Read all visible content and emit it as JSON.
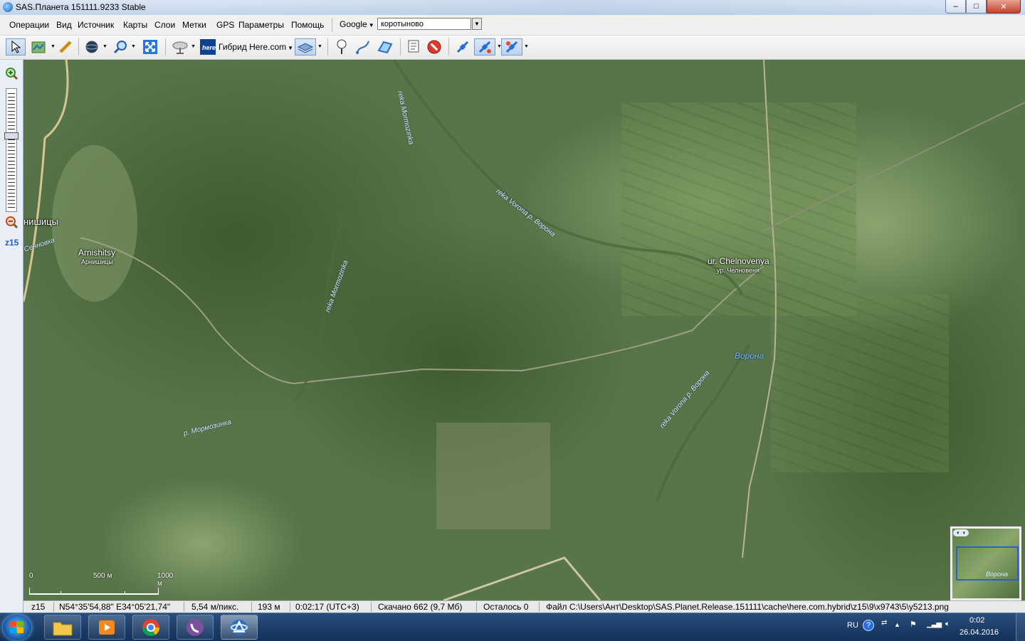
{
  "window": {
    "title": "SAS.Планета 151111.9233 Stable",
    "controls": {
      "minimize": "–",
      "maximize": "□",
      "close": "✕"
    }
  },
  "menu": {
    "items": [
      "Операции",
      "Вид",
      "Источник",
      "Карты",
      "Слои",
      "Метки",
      "GPS",
      "Параметры",
      "Помощь"
    ],
    "search_source": "Google",
    "search_value": "коротыново"
  },
  "toolbar": {
    "map_type_label": "Гибрид Here.com",
    "buttons": [
      "select-arrow",
      "map-source",
      "ruler",
      "globe",
      "zoom-magnifier",
      "fullscreen",
      "satellite-dish",
      "here-logo",
      "layers",
      "placemark",
      "path-tool",
      "polygon-tool",
      "marks-list",
      "delete-marks",
      "gps-connect",
      "gps-track",
      "gps-center"
    ]
  },
  "zoom": {
    "level": "z15"
  },
  "map": {
    "labels": {
      "nishitsy": "нишицы",
      "sennovka": "Сенновка",
      "arnishitsy": "Arnishitsy",
      "arnishitsy_ru": "Арнишицы",
      "mormozinka_top": "reka Mormozinka",
      "mormozinka_mid": "reka Mormozinka",
      "vorona_top": "reka Vorona р. Ворона",
      "chelnovenya": "ur. Chelnovenya",
      "chelnovenya_ru": "ур. Челновеня",
      "vorona_blue": "Ворона",
      "vorona_low": "reka Vorona р. Ворона",
      "mormozinka_ru": "р. Мормозинка"
    },
    "scale": {
      "zero": "0",
      "mid": "500 м",
      "end": "1000 м"
    },
    "minimap_label": "Ворона"
  },
  "statusbar": {
    "zoom": "z15",
    "coords": "N54°35'54,88\" E34°05'21,74\"",
    "resolution": "5,54 м/пикс.",
    "distance": "193 м",
    "time": "0:02:17 (UTC+3)",
    "downloaded": "Скачано 662 (9,7 Мб)",
    "remaining": "Осталось 0",
    "file": "Файл C:\\Users\\Ант\\Desktop\\SAS.Planet.Release.151111\\cache\\here.com.hybrid\\z15\\9\\x9743\\5\\y5213.png"
  },
  "taskbar": {
    "apps": [
      "explorer",
      "media-player",
      "chrome",
      "viber",
      "sas-planet"
    ],
    "lang": "RU",
    "clock_time": "0:02",
    "clock_date": "26.04.2016"
  }
}
